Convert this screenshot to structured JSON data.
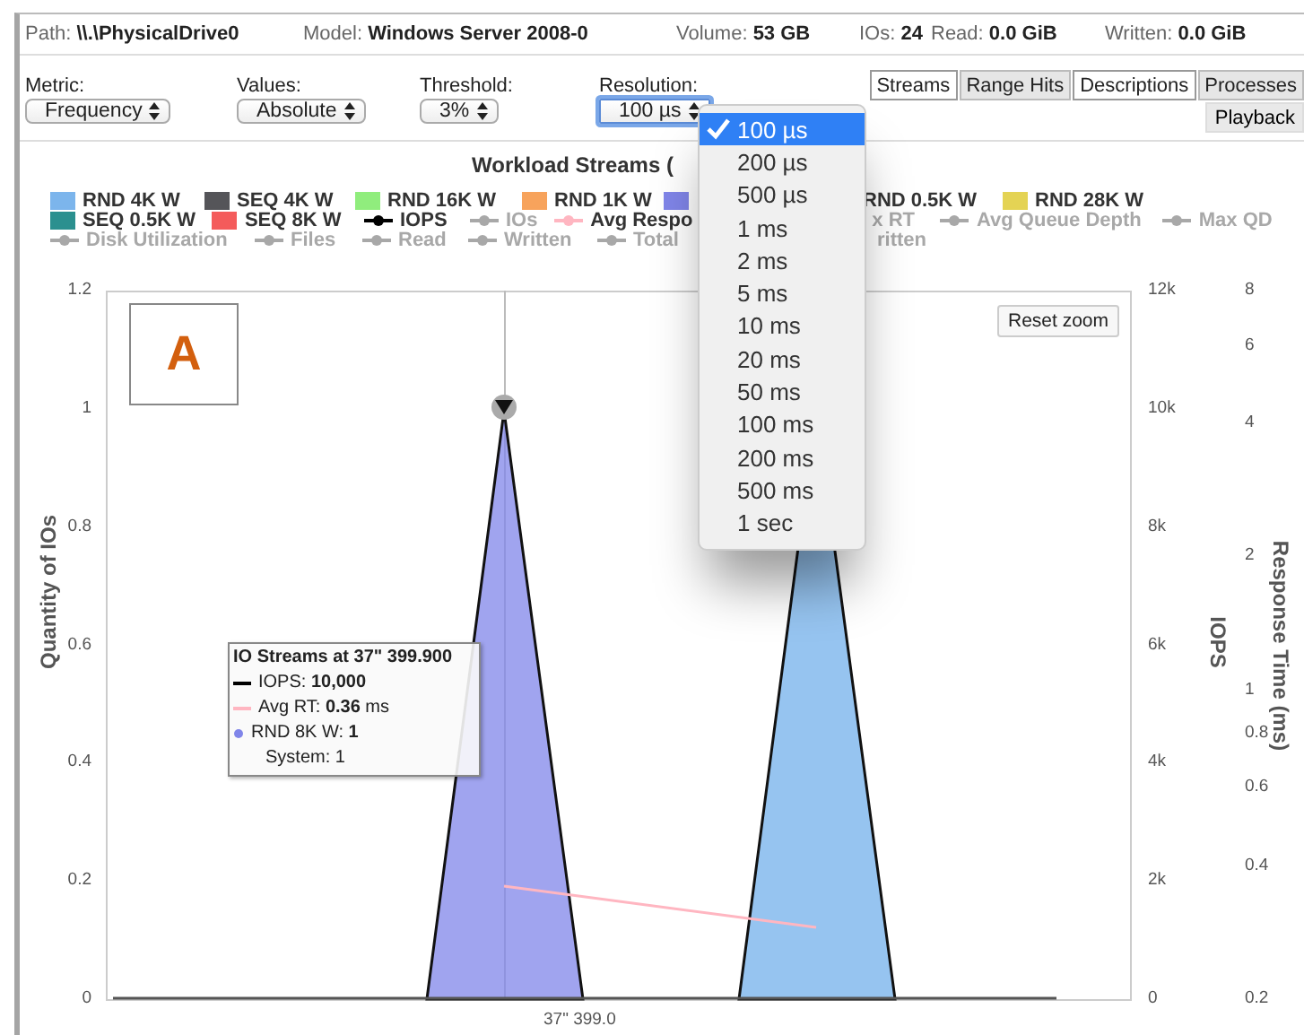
{
  "info_bar": [
    {
      "label": "Path:",
      "value": "\\\\.\\PhysicalDrive0"
    },
    {
      "label": "Model:",
      "value": "Windows Server 2008-0"
    },
    {
      "label": "Volume:",
      "value": "53 GB"
    },
    {
      "label": "IOs:",
      "value": "24"
    },
    {
      "label": "Read:",
      "value": "0.0 GiB"
    },
    {
      "label": "Written:",
      "value": "0.0 GiB"
    }
  ],
  "controls": [
    {
      "label": "Metric:",
      "value": "Frequency",
      "focused": false
    },
    {
      "label": "Values:",
      "value": "Absolute",
      "focused": false
    },
    {
      "label": "Threshold:",
      "value": "3%",
      "focused": false
    },
    {
      "label": "Resolution:",
      "value": "100 µs",
      "focused": true
    }
  ],
  "tabs": [
    {
      "label": "Streams",
      "selected": true
    },
    {
      "label": "Range Hits",
      "selected": false
    },
    {
      "label": "Descriptions",
      "selected": true
    },
    {
      "label": "Processes",
      "selected": false
    }
  ],
  "playback_button": "Playback",
  "resolution_menu": [
    {
      "label": "100 µs",
      "selected": true
    },
    {
      "label": "200 µs",
      "selected": false
    },
    {
      "label": "500 µs",
      "selected": false
    },
    {
      "label": "1 ms",
      "selected": false
    },
    {
      "label": "2 ms",
      "selected": false
    },
    {
      "label": "5 ms",
      "selected": false
    },
    {
      "label": "10 ms",
      "selected": false
    },
    {
      "label": "20 ms",
      "selected": false
    },
    {
      "label": "50 ms",
      "selected": false
    },
    {
      "label": "100 ms",
      "selected": false
    },
    {
      "label": "200 ms",
      "selected": false
    },
    {
      "label": "500 ms",
      "selected": false
    },
    {
      "label": "1 sec",
      "selected": false
    }
  ],
  "chart": {
    "title": "Workload Streams (",
    "legend": [
      [
        {
          "kind": "swatch",
          "label": "RND 4K W",
          "color": "#7cb5ec",
          "hidden": false
        },
        {
          "kind": "swatch",
          "label": "SEQ 4K W",
          "color": "#555559",
          "hidden": false
        },
        {
          "kind": "swatch",
          "label": "RND 16K W",
          "color": "#90ed7d",
          "hidden": false
        },
        {
          "kind": "swatch",
          "label": "RND 1K W",
          "color": "#f7a35c",
          "hidden": false
        },
        {
          "kind": "swatch",
          "color": "#8085e9",
          "hidden": false
        },
        {
          "kind": "text",
          "label": "RND 0.5K W",
          "hidden": false
        },
        {
          "kind": "swatch",
          "label": "RND 28K W",
          "color": "#e4d354",
          "hidden": false
        }
      ],
      [
        {
          "kind": "swatch",
          "label": "SEQ 0.5K W",
          "color": "#2b908f",
          "hidden": false
        },
        {
          "kind": "swatch",
          "label": "SEQ 8K W",
          "color": "#f45b5b",
          "hidden": false
        },
        {
          "kind": "line",
          "label": "IOPS",
          "color": "#000000",
          "hidden": false
        },
        {
          "kind": "line",
          "label": "IOs",
          "hidden": true
        },
        {
          "kind": "line",
          "label": "Avg Respo",
          "color": "#ffb6c1",
          "hidden": false
        },
        {
          "kind": "text",
          "label": "x RT",
          "hidden": true
        },
        {
          "kind": "line",
          "label": "Avg Queue Depth",
          "hidden": true
        },
        {
          "kind": "line",
          "label": "Max QD",
          "hidden": true
        }
      ],
      [
        {
          "kind": "line",
          "label": "Disk Utilization",
          "hidden": true
        },
        {
          "kind": "line",
          "label": "Files",
          "hidden": true
        },
        {
          "kind": "line",
          "label": "Read",
          "hidden": true
        },
        {
          "kind": "line",
          "label": "Written",
          "hidden": true
        },
        {
          "kind": "line",
          "label": "Total",
          "hidden": true
        },
        {
          "kind": "text",
          "label": "ritten",
          "hidden": true
        }
      ]
    ],
    "badge": "A",
    "reset_button": "Reset zoom",
    "y_axis_left": {
      "title": "Quantity of IOs",
      "ticks": [
        "1.2",
        "1",
        "0.8",
        "0.6",
        "0.4",
        "0.2",
        "0"
      ]
    },
    "y_axis_iops": {
      "title": "IOPS",
      "ticks": [
        "12k",
        "10k",
        "8k",
        "6k",
        "4k",
        "2k",
        "0"
      ]
    },
    "y_axis_rt": {
      "title": "Response Time (ms)",
      "ticks": [
        "8",
        "6",
        "4",
        "2",
        "1",
        "0.8",
        "0.6",
        "0.4",
        "0.2"
      ]
    },
    "x_label": "37\" 399.0",
    "tooltip": {
      "title": "IO Streams at 37\" 399.900",
      "lines": [
        {
          "kind": "line",
          "color": "#000000",
          "text": "IOPS: **10,000**"
        },
        {
          "kind": "line",
          "color": "#ffb6c1",
          "text": "Avg RT: **0.36** ms"
        },
        {
          "kind": "dot",
          "color": "#8085e9",
          "text": "RND 8K W: **1**"
        },
        {
          "kind": "plain",
          "text": "System: 1"
        }
      ]
    }
  }
}
